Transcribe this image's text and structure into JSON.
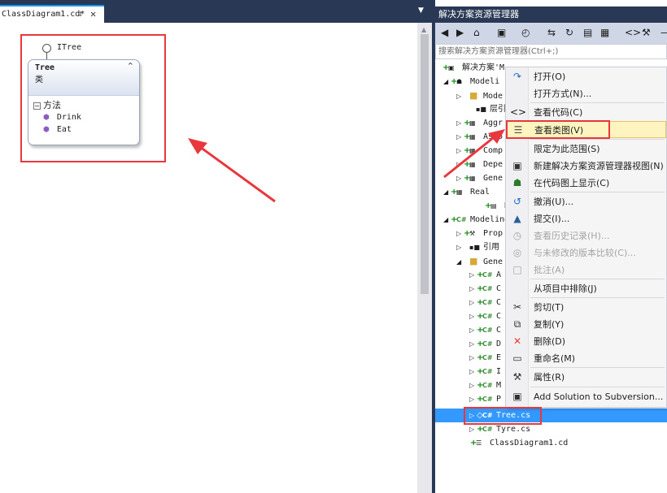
{
  "document": {
    "tab_label": "ClassDiagram1.cd*",
    "pin_glyph": "↧",
    "close_glyph": "✕",
    "dropdown_glyph": "▼"
  },
  "diagram": {
    "interface_label": "ITree",
    "class_name": "Tree",
    "class_kind": "类",
    "collapse_glyph": "⌃",
    "methods_header": "方法",
    "methods_toggle": "−",
    "methods": [
      {
        "name": "Drink"
      },
      {
        "name": "Eat"
      }
    ]
  },
  "solution_explorer": {
    "title": "解决方案资源管理器",
    "search_placeholder": "搜索解决方案资源管理器(Ctrl+;)",
    "toolbar_glyphs": [
      "◀",
      "▶",
      "⌂",
      "▣",
      "◴",
      "⇆",
      "↻",
      "▤",
      "▦",
      "<>",
      "⚒",
      "—"
    ],
    "nodes": [
      {
        "tw": "",
        "pl": "+",
        "ic": "▣",
        "text": "解决方案'M"
      },
      {
        "tw": "◢",
        "pl": "+",
        "ic": "☗",
        "text": "Modeli"
      },
      {
        "tw": "▷",
        "pl": "",
        "ic": "■",
        "text": "Mode"
      },
      {
        "tw": "",
        "pl": "",
        "ic": "▪■",
        "text": "层引"
      },
      {
        "tw": "▷",
        "pl": "+",
        "ic": "▦",
        "text": "Aggr"
      },
      {
        "tw": "▷",
        "pl": "+",
        "ic": "▦",
        "text": "Asso"
      },
      {
        "tw": "▷",
        "pl": "+",
        "ic": "▦",
        "text": "Comp"
      },
      {
        "tw": "▷",
        "pl": "+",
        "ic": "▦",
        "text": "Depe"
      },
      {
        "tw": "▷",
        "pl": "+",
        "ic": "▦",
        "text": "Gene"
      },
      {
        "tw": "◢",
        "pl": "+",
        "ic": "▦",
        "text": "Real"
      },
      {
        "tw": "",
        "pl": "+",
        "ic": "▤",
        "text": "R"
      },
      {
        "tw": "◢",
        "pl": "+",
        "ic": "C#",
        "text": "Modeling"
      },
      {
        "tw": "▷",
        "pl": "+",
        "ic": "⚒",
        "text": "Prop"
      },
      {
        "tw": "▷",
        "pl": "",
        "ic": "▪■",
        "text": "引用"
      },
      {
        "tw": "◢",
        "pl": "",
        "ic": "■",
        "text": "Gene"
      },
      {
        "tw": "▷",
        "pl": "+",
        "ic": "C#",
        "text": "A"
      },
      {
        "tw": "▷",
        "pl": "+",
        "ic": "C#",
        "text": "C"
      },
      {
        "tw": "▷",
        "pl": "+",
        "ic": "C#",
        "text": "C"
      },
      {
        "tw": "▷",
        "pl": "+",
        "ic": "C#",
        "text": "C"
      },
      {
        "tw": "▷",
        "pl": "+",
        "ic": "C#",
        "text": "C"
      },
      {
        "tw": "▷",
        "pl": "+",
        "ic": "C#",
        "text": "D"
      },
      {
        "tw": "▷",
        "pl": "+",
        "ic": "C#",
        "text": "E"
      },
      {
        "tw": "▷",
        "pl": "+",
        "ic": "C#",
        "text": "I"
      },
      {
        "tw": "▷",
        "pl": "+",
        "ic": "C#",
        "text": "M"
      },
      {
        "tw": "▷",
        "pl": "+",
        "ic": "C#",
        "text": "P"
      },
      {
        "tw": "▷",
        "pl": "◇",
        "ic": "C#",
        "text": "Tree.cs"
      },
      {
        "tw": "▷",
        "pl": "+",
        "ic": "C#",
        "text": "Tyre.cs"
      },
      {
        "tw": "",
        "pl": "+",
        "ic": "☰",
        "text": "ClassDiagram1.cd"
      }
    ]
  },
  "context_menu": {
    "items": [
      {
        "icon": "↷",
        "label": "打开(O)",
        "disabled": false
      },
      {
        "icon": "",
        "label": "打开方式(N)...",
        "disabled": false
      },
      {
        "icon": "<>",
        "label": "查看代码(C)",
        "disabled": false
      },
      {
        "icon": "☰",
        "label": "查看类图(V)",
        "disabled": false
      },
      {
        "icon": "",
        "label": "限定为此范围(S)",
        "disabled": false
      },
      {
        "icon": "▣",
        "label": "新建解决方案资源管理器视图(N)",
        "disabled": false
      },
      {
        "icon": "☗",
        "label": "在代码图上显示(C)",
        "disabled": false
      },
      {
        "icon": "↺",
        "label": "撤消(U)...",
        "disabled": false
      },
      {
        "icon": "▲",
        "label": "提交(I)...",
        "disabled": false
      },
      {
        "icon": "◷",
        "label": "查看历史记录(H)...",
        "disabled": true
      },
      {
        "icon": "◎",
        "label": "与未修改的版本比较(C)...",
        "disabled": true
      },
      {
        "icon": "□",
        "label": "批注(A)",
        "disabled": true
      },
      {
        "icon": "",
        "label": "从项目中排除(J)",
        "disabled": false
      },
      {
        "icon": "✂",
        "label": "剪切(T)",
        "disabled": false
      },
      {
        "icon": "⧉",
        "label": "复制(Y)",
        "disabled": false
      },
      {
        "icon": "✕",
        "label": "删除(D)",
        "disabled": false
      },
      {
        "icon": "▭",
        "label": "重命名(M)",
        "disabled": false
      },
      {
        "icon": "⚒",
        "label": "属性(R)",
        "disabled": false
      },
      {
        "icon": "▣",
        "label": "Add Solution to Subversion...",
        "disabled": false
      }
    ]
  },
  "colors": {
    "tab_bar": "#293955",
    "selection": "#3399ff",
    "annotation_red": "#e8383d",
    "menu_highlight": "#fdf4bf"
  }
}
